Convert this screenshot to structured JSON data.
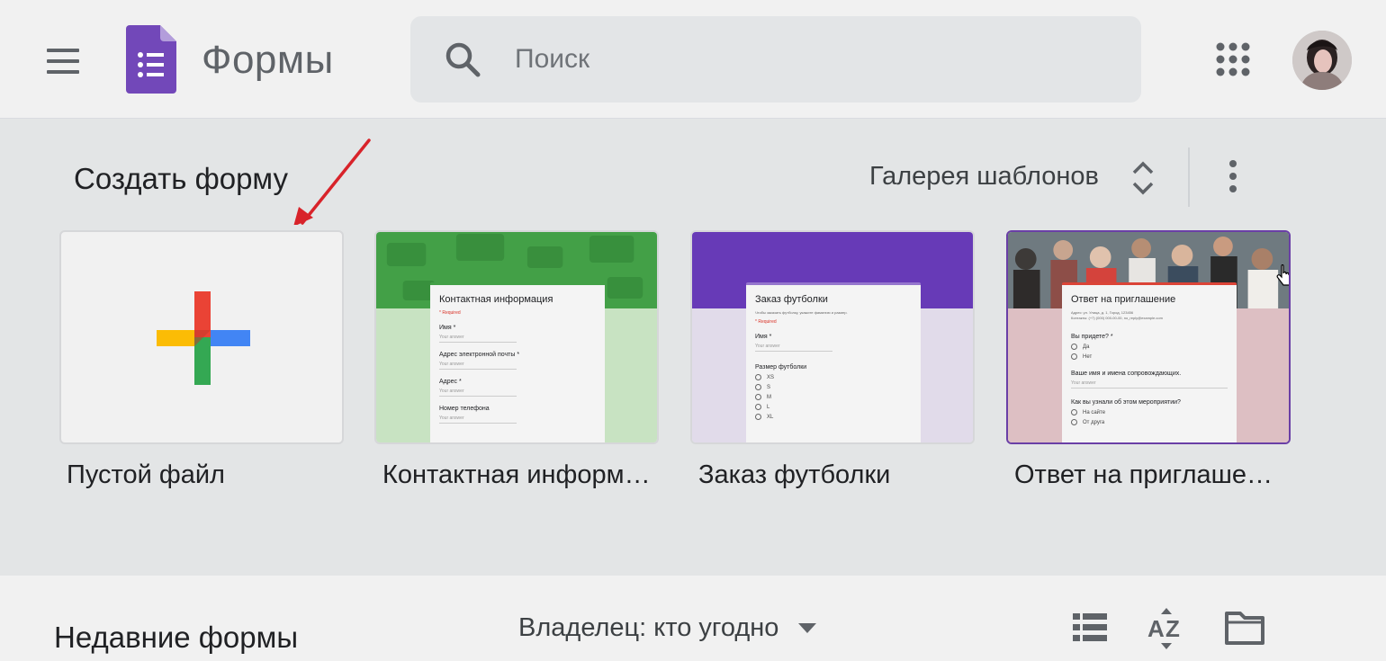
{
  "header": {
    "menu_icon": "hamburger-menu-icon",
    "logo_icon": "google-forms-logo-icon",
    "app_title": "Формы",
    "search": {
      "placeholder": "Поиск",
      "value": "",
      "icon": "search-icon"
    },
    "apps_icon": "apps-grid-icon",
    "avatar_icon": "account-avatar"
  },
  "templates": {
    "section_title": "Создать форму",
    "gallery_label": "Галерея шаблонов",
    "gallery_toggle_icon": "unfold-icon",
    "more_icon": "more-vertical-icon",
    "items": [
      {
        "label": "Пустой файл",
        "icon": "plus-icon"
      },
      {
        "label": "Контактная информация",
        "accent": "#43a047",
        "form": {
          "title": "Контактная информация",
          "required": "* Required",
          "questions": [
            {
              "label": "Имя *",
              "answer": "Your answer"
            },
            {
              "label": "Адрес электронной почты *",
              "answer": "Your answer"
            },
            {
              "label": "Адрес *",
              "answer": "Your answer"
            },
            {
              "label": "Номер телефона",
              "answer": "Your answer"
            }
          ]
        }
      },
      {
        "label": "Заказ футболки",
        "accent": "#673ab7",
        "form": {
          "title": "Заказ футболки",
          "description": "Чтобы заказать футболку, укажите фамилию и размер.",
          "required": "* Required",
          "name_label": "Имя *",
          "answer": "Your answer",
          "size_label": "Размер футболки",
          "sizes": [
            "XS",
            "S",
            "M",
            "L",
            "XL"
          ]
        }
      },
      {
        "label": "Ответ на приглашение",
        "accent": "#db4437",
        "form": {
          "title": "Ответ на приглашение",
          "address": "Адрес: ул. Улица, д. 1, Город, 123456",
          "contacts": "Контакты: (+7) (000) 000-00-00, no_reply@example.com",
          "q1": "Вы придете? *",
          "q1_options": [
            "Да",
            "Нет"
          ],
          "q2": "Ваше имя и имена сопровождающих.",
          "answer": "Your answer",
          "q3": "Как вы узнали об этом мероприятии?",
          "q3_options": [
            "На сайте",
            "От друга"
          ]
        }
      }
    ]
  },
  "recent": {
    "title": "Недавние формы",
    "owner_filter": "Владелец: кто угодно",
    "caret_icon": "dropdown-caret-icon",
    "list_view_icon": "list-view-icon",
    "sort_icon": "sort-az-icon",
    "folder_icon": "folder-icon"
  },
  "colors": {
    "forms_purple": "#7248b9",
    "plus_red": "#ea4335",
    "plus_blue": "#4285f4",
    "plus_green": "#34a853",
    "plus_yellow": "#fbbc05",
    "arrow_red": "#d8232a"
  }
}
